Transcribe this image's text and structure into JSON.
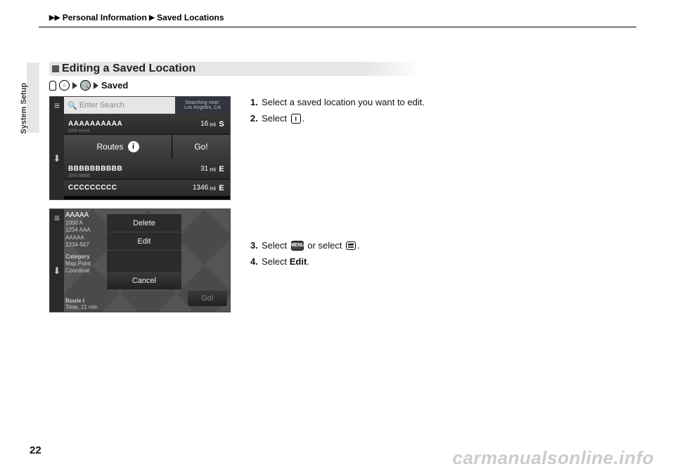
{
  "header": {
    "crumb1": "Personal Information",
    "crumb2": "Saved Locations"
  },
  "sidebar_tab": "System Setup",
  "section_title": "Editing a Saved Location",
  "path_end": "Saved",
  "screenshot1": {
    "search_placeholder": "Enter Search",
    "near_line1": "Searching near:",
    "near_line2": "Los Angeles, CA",
    "rows": [
      {
        "name": "AAAAAAAAAA",
        "sub": "1000 AAAA",
        "dist": "16",
        "unit": "mi",
        "dir": "S"
      },
      {
        "name": "BBBBBBBBBB",
        "sub": "2000 BBBB",
        "dist": "31",
        "unit": "mi",
        "dir": "E"
      },
      {
        "name": "CCCCCCCCC",
        "sub": "",
        "dist": "1346",
        "unit": "mi",
        "dir": "E"
      }
    ],
    "routes_label": "Routes",
    "go_label": "Go!"
  },
  "screenshot2": {
    "name": "AAAAA",
    "addr": "1000 A",
    "line1": "1234 AAA",
    "line2": "AAAAA",
    "line3": "1234-567",
    "cat_label": "Category",
    "mp_label": "Map Point",
    "coord_label": "Coordinat",
    "route_label": "Route I",
    "time_label": "Time: 21 min",
    "popup": {
      "delete": "Delete",
      "edit": "Edit",
      "cancel": "Cancel"
    },
    "go_label": "Go!"
  },
  "instructions": {
    "s1": "Select a saved location you want to edit.",
    "s2_pre": "Select ",
    "s3_pre": "Select ",
    "s3_mid": " or select ",
    "s4_pre": "Select ",
    "s4_bold": "Edit",
    "menu_label": "MENU"
  },
  "page_number": "22",
  "watermark": "carmanualsonline.info"
}
